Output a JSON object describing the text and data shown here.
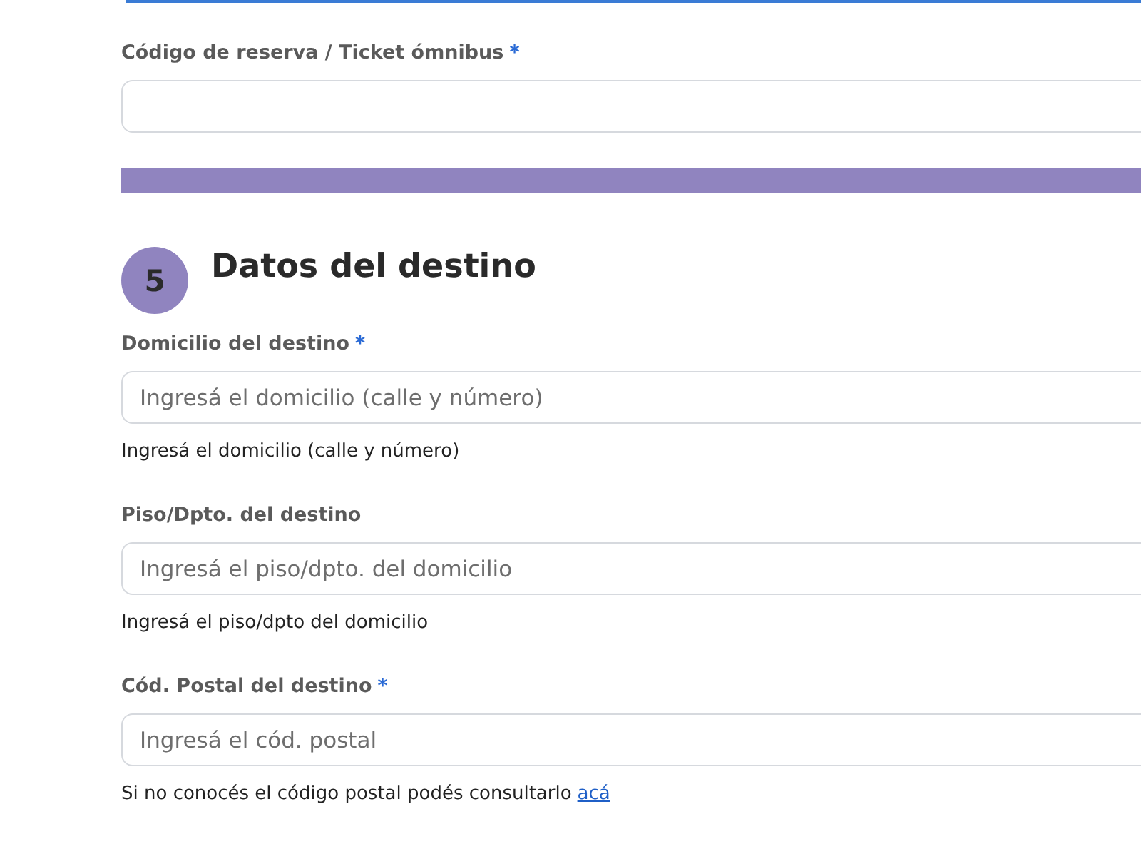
{
  "previous_fields": [
    {
      "label": "Código de reserva / Ticket ómnibus",
      "mark": "*"
    }
  ],
  "section": {
    "number": "5",
    "title": "Datos del destino"
  },
  "fields": [
    {
      "label": "Domicilio del destino",
      "mark": "*",
      "placeholder": "Ingresá el domicilio (calle y número)",
      "help": "Ingresá el domicilio (calle y número)"
    },
    {
      "label": "Piso/Dpto. del destino",
      "placeholder": "Ingresá el piso/dpto. del domicilio",
      "help": "Ingresá el piso/dpto del domicilio"
    },
    {
      "label": "Cód. Postal del destino",
      "mark": "*",
      "placeholder": "Ingresá el cód. postal",
      "help": "Si no conocés el código postal podés consultarlo",
      "help_link": "acá"
    }
  ]
}
